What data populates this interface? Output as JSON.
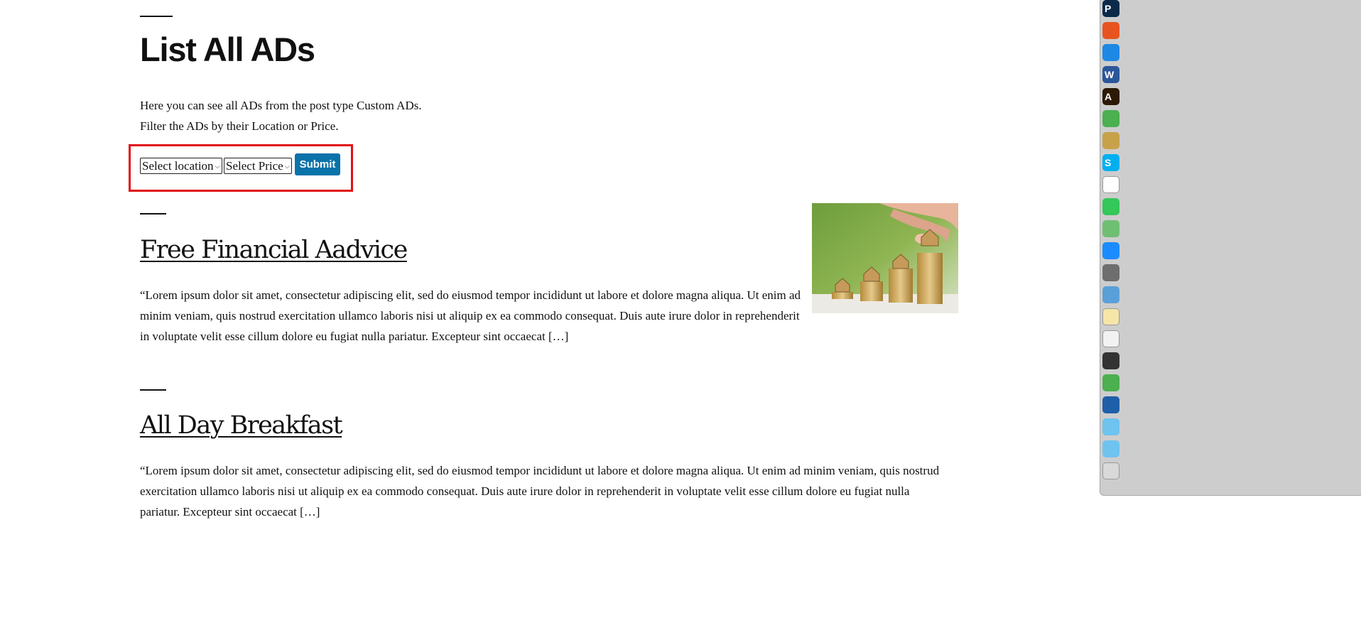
{
  "page": {
    "title": "List All ADs",
    "intro_line1": "Here you can see all ADs from the post type Custom ADs.",
    "intro_line2": "Filter the ADs by their Location or Price."
  },
  "filter": {
    "location_select": "Select location",
    "price_select": "Select Price",
    "submit_label": "Submit",
    "highlight_color": "#e10f14",
    "button_color": "#0a73aa"
  },
  "posts": [
    {
      "title": "Free Financial Aadvice",
      "excerpt": "“Lorem ipsum dolor sit amet, consectetur adipiscing elit, sed do eiusmod tempor incididunt ut labore et dolore magna aliqua. Ut enim ad minim veniam, quis nostrud exercitation ullamco laboris nisi ut aliquip ex ea commodo consequat. Duis aute irure dolor in reprehenderit in voluptate velit esse cillum dolore eu fugiat nulla pariatur. Excepteur sint occaecat […]",
      "image": "coins-with-houses-photo"
    },
    {
      "title": "All Day Breakfast",
      "excerpt": "“Lorem ipsum dolor sit amet, consectetur adipiscing elit, sed do eiusmod tempor incididunt ut labore et dolore magna aliqua. Ut enim ad minim veniam, quis nostrud exercitation ullamco laboris nisi ut aliquip ex ea commodo consequat. Duis aute irure dolor in reprehenderit in voluptate velit esse cillum dolore eu fugiat nulla pariatur. Excepteur sint occaecat […]"
    }
  ],
  "dock": {
    "icons": [
      {
        "name": "photoshop-icon",
        "label": "P",
        "color": "#0b2a4a"
      },
      {
        "name": "firefox-icon",
        "label": "",
        "color": "#e8541f"
      },
      {
        "name": "safari-icon",
        "label": "",
        "color": "#1e88e5"
      },
      {
        "name": "word-icon",
        "label": "W",
        "color": "#2b579a"
      },
      {
        "name": "illustrator-icon",
        "label": "A",
        "color": "#2d1a05"
      },
      {
        "name": "leaf-app-icon",
        "label": "",
        "color": "#4caf50"
      },
      {
        "name": "coins-app-icon",
        "label": "",
        "color": "#c7a24a"
      },
      {
        "name": "skype-icon",
        "label": "S",
        "color": "#00aff0"
      },
      {
        "name": "slack-icon",
        "label": "",
        "color": "#ffffff"
      },
      {
        "name": "messages-icon",
        "label": "",
        "color": "#34c759"
      },
      {
        "name": "maps-icon",
        "label": "",
        "color": "#6fbf73"
      },
      {
        "name": "app-store-icon",
        "label": "",
        "color": "#1a8cff"
      },
      {
        "name": "system-preferences-icon",
        "label": "",
        "color": "#6e6e6e"
      },
      {
        "name": "preview-icon",
        "label": "",
        "color": "#5aa0d8"
      },
      {
        "name": "notes-icon",
        "label": "",
        "color": "#f5e6a8"
      },
      {
        "name": "document-icon",
        "label": "",
        "color": "#f2f2f2"
      },
      {
        "name": "podcasts-icon",
        "label": "",
        "color": "#333333"
      },
      {
        "name": "leaf-app-2-icon",
        "label": "",
        "color": "#4caf50"
      },
      {
        "name": "thunderbird-icon",
        "label": "",
        "color": "#1f5fa8"
      },
      {
        "name": "folder-applications-icon",
        "label": "",
        "color": "#6fc3ef"
      },
      {
        "name": "folder-downloads-icon",
        "label": "",
        "color": "#6fc3ef"
      },
      {
        "name": "trash-icon",
        "label": "",
        "color": "#d9d9d9"
      }
    ]
  }
}
